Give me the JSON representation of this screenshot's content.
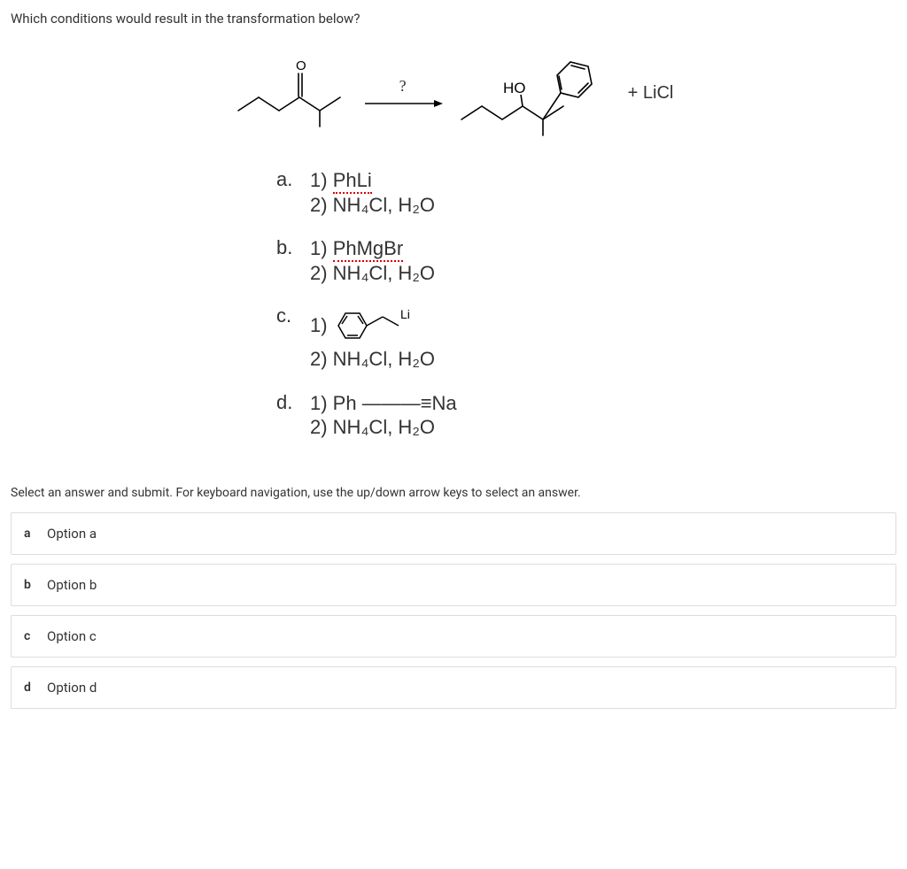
{
  "question": "Which conditions would result in the transformation below?",
  "reaction": {
    "arrow_label": "?",
    "byproduct": "+   LiCl",
    "product_label": "HO"
  },
  "condition_options": {
    "a": {
      "letter": "a.",
      "line1_pre": "1) ",
      "reagent": "PhLi",
      "line2": "2) NH₄Cl, H₂O"
    },
    "b": {
      "letter": "b.",
      "line1_pre": "1) ",
      "reagent": "PhMgBr",
      "line2": "2) NH₄Cl, H₂O"
    },
    "c": {
      "letter": "c.",
      "line1_pre": "1) ",
      "reagent_suffix": "Li",
      "line2": "2) NH₄Cl, H₂O"
    },
    "d": {
      "letter": "d.",
      "line1": "1) Ph ———≡Na",
      "line2": "2) NH₄Cl, H₂O"
    }
  },
  "instructions": "Select an answer and submit. For keyboard navigation, use the up/down arrow keys to select an answer.",
  "answers": {
    "a": {
      "key": "a",
      "label": "Option a"
    },
    "b": {
      "key": "b",
      "label": "Option b"
    },
    "c": {
      "key": "c",
      "label": "Option c"
    },
    "d": {
      "key": "d",
      "label": "Option d"
    }
  }
}
